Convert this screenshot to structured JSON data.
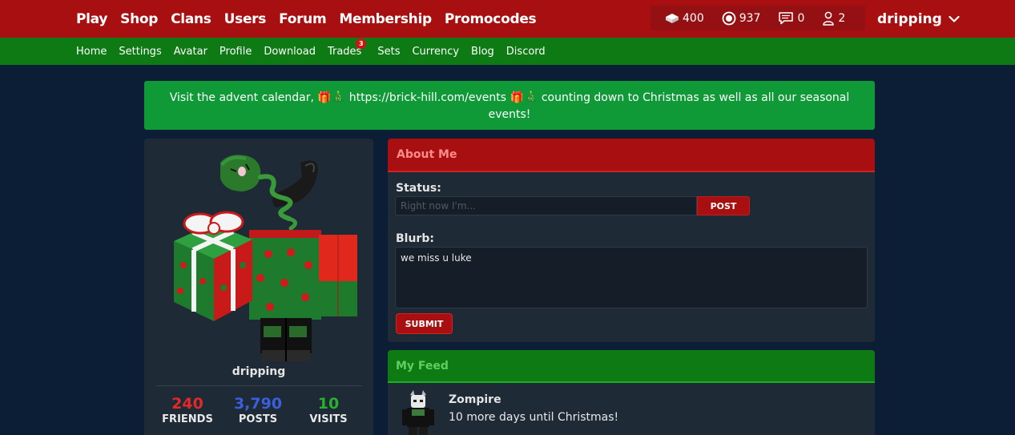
{
  "topnav": {
    "links": [
      "Play",
      "Shop",
      "Clans",
      "Users",
      "Forum",
      "Membership",
      "Promocodes"
    ],
    "bucks": "400",
    "bits": "937",
    "messages": "0",
    "friend_requests": "2",
    "username": "dripping"
  },
  "subnav": {
    "links": [
      "Home",
      "Settings",
      "Avatar",
      "Profile",
      "Download",
      "Trades",
      "Sets",
      "Currency",
      "Blog",
      "Discord"
    ],
    "trades_badge": "3"
  },
  "banner": {
    "text": "Visit the advent calendar, 🎁🎄 https://brick-hill.com/events 🎁🎄 counting down to Christmas as well as all our seasonal events!"
  },
  "profile": {
    "username": "dripping",
    "friends": "240",
    "friends_label": "FRIENDS",
    "posts": "3,790",
    "posts_label": "POSTS",
    "visits": "10",
    "visits_label": "VISITS"
  },
  "about": {
    "title": "About Me",
    "status_label": "Status:",
    "status_placeholder": "Right now I'm...",
    "post_label": "POST",
    "blurb_label": "Blurb:",
    "blurb_value": "we miss u luke",
    "submit_label": "SUBMIT"
  },
  "feed": {
    "title": "My Feed",
    "items": [
      {
        "user": "Zompire",
        "text": "10 more days until Christmas!"
      }
    ]
  },
  "colors": {
    "red": "#a80f10",
    "green": "#0d7a13",
    "background": "#0c1d36",
    "card": "#1e2a36",
    "friends": "#e02a2a",
    "posts": "#3a5fdb",
    "visits": "#29b02e"
  }
}
